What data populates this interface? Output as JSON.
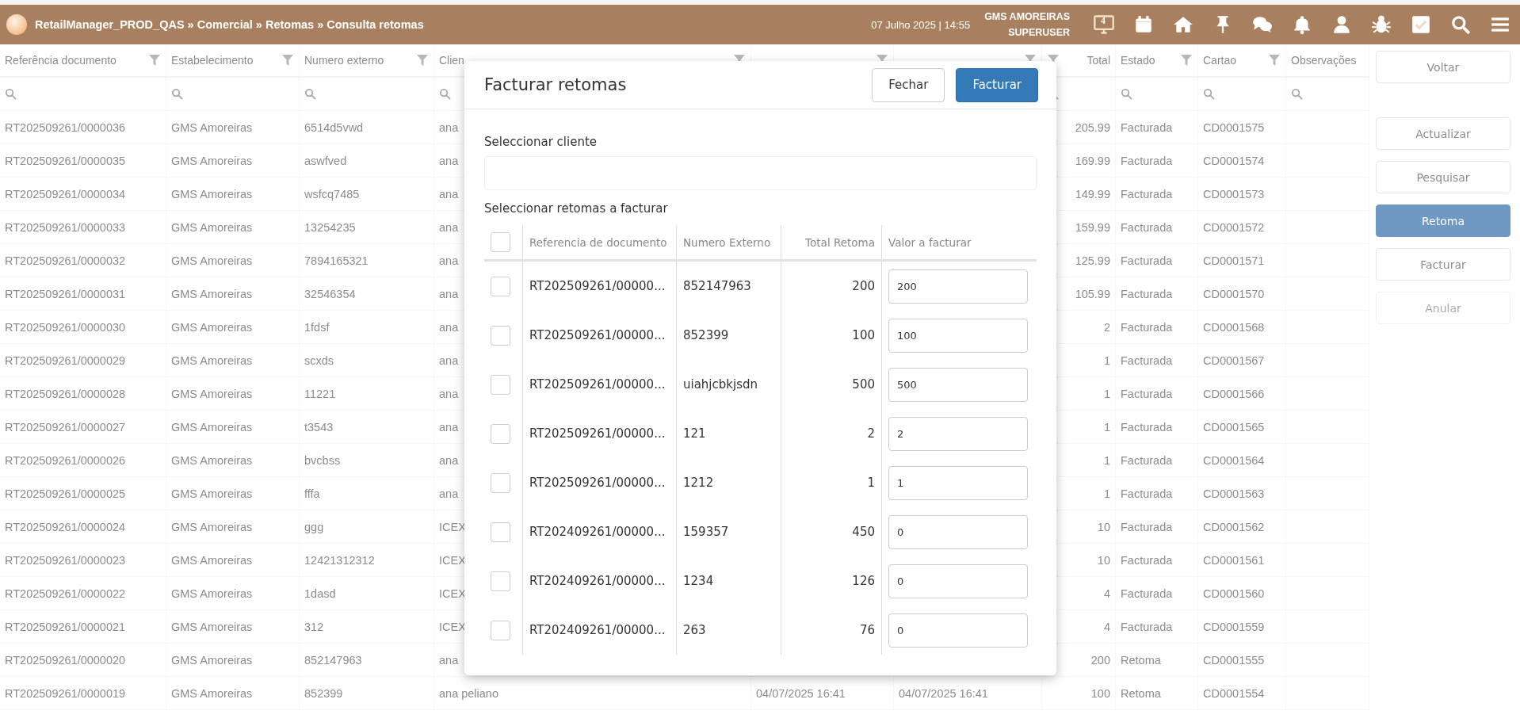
{
  "header": {
    "breadcrumb": "RetailManager_PROD_QAS » Comercial » Retomas » Consulta retomas",
    "datetime": "07 Julho 2025 | 14:55",
    "store": "GMS AMOREIRAS",
    "user": "SUPERUSER",
    "monitor_badge": "4"
  },
  "table": {
    "columns": [
      {
        "label": "Referência documento",
        "filter": true
      },
      {
        "label": "Estabelecimento",
        "filter": true
      },
      {
        "label": "Numero externo",
        "filter": true
      },
      {
        "label": "Clien",
        "filter": true
      },
      {
        "filter": true
      },
      {
        "filter": true
      },
      {
        "label": "Total",
        "filter": true
      },
      {
        "label": "Estado",
        "filter": true
      },
      {
        "label": "Cartao",
        "filter": true
      },
      {
        "label": "Observações",
        "filter": false
      }
    ],
    "rows": [
      {
        "reference": "RT202509261/0000036",
        "establishment": "GMS Amoreiras",
        "external": "6514d5vwd",
        "client": "ana",
        "total": "205.99",
        "status": "Facturada",
        "card": "CD0001575"
      },
      {
        "reference": "RT202509261/0000035",
        "establishment": "GMS Amoreiras",
        "external": "aswfved",
        "client": "ana",
        "total": "169.99",
        "status": "Facturada",
        "card": "CD0001574"
      },
      {
        "reference": "RT202509261/0000034",
        "establishment": "GMS Amoreiras",
        "external": "wsfcq7485",
        "client": "ana",
        "total": "149.99",
        "status": "Facturada",
        "card": "CD0001573"
      },
      {
        "reference": "RT202509261/0000033",
        "establishment": "GMS Amoreiras",
        "external": "13254235",
        "client": "ana",
        "total": "159.99",
        "status": "Facturada",
        "card": "CD0001572"
      },
      {
        "reference": "RT202509261/0000032",
        "establishment": "GMS Amoreiras",
        "external": "7894165321",
        "client": "ana",
        "total": "125.99",
        "status": "Facturada",
        "card": "CD0001571"
      },
      {
        "reference": "RT202509261/0000031",
        "establishment": "GMS Amoreiras",
        "external": "32546354",
        "client": "ana",
        "total": "105.99",
        "status": "Facturada",
        "card": "CD0001570"
      },
      {
        "reference": "RT202509261/0000030",
        "establishment": "GMS Amoreiras",
        "external": "1fdsf",
        "client": "ana",
        "total": "2",
        "status": "Facturada",
        "card": "CD0001568"
      },
      {
        "reference": "RT202509261/0000029",
        "establishment": "GMS Amoreiras",
        "external": "scxds",
        "client": "ana",
        "total": "1",
        "status": "Facturada",
        "card": "CD0001567"
      },
      {
        "reference": "RT202509261/0000028",
        "establishment": "GMS Amoreiras",
        "external": "11221",
        "client": "ana",
        "total": "1",
        "status": "Facturada",
        "card": "CD0001566"
      },
      {
        "reference": "RT202509261/0000027",
        "establishment": "GMS Amoreiras",
        "external": "t3543",
        "client": "ana",
        "total": "1",
        "status": "Facturada",
        "card": "CD0001565"
      },
      {
        "reference": "RT202509261/0000026",
        "establishment": "GMS Amoreiras",
        "external": "bvcbss",
        "client": "ana",
        "total": "1",
        "status": "Facturada",
        "card": "CD0001564"
      },
      {
        "reference": "RT202509261/0000025",
        "establishment": "GMS Amoreiras",
        "external": "fffa",
        "client": "ana",
        "total": "1",
        "status": "Facturada",
        "card": "CD0001563"
      },
      {
        "reference": "RT202509261/0000024",
        "establishment": "GMS Amoreiras",
        "external": "ggg",
        "client": "ICEX",
        "total": "10",
        "status": "Facturada",
        "card": "CD0001562"
      },
      {
        "reference": "RT202509261/0000023",
        "establishment": "GMS Amoreiras",
        "external": "12421312312",
        "client": "ICEX",
        "total": "10",
        "status": "Facturada",
        "card": "CD0001561"
      },
      {
        "reference": "RT202509261/0000022",
        "establishment": "GMS Amoreiras",
        "external": "1dasd",
        "client": "ICEX",
        "total": "4",
        "status": "Facturada",
        "card": "CD0001560"
      },
      {
        "reference": "RT202509261/0000021",
        "establishment": "GMS Amoreiras",
        "external": "312",
        "client": "ICEX",
        "total": "4",
        "status": "Facturada",
        "card": "CD0001559"
      },
      {
        "reference": "RT202509261/0000020",
        "establishment": "GMS Amoreiras",
        "external": "852147963",
        "client": "ana",
        "total": "200",
        "status": "Retoma",
        "card": "CD0001555"
      },
      {
        "reference": "RT202509261/0000019",
        "establishment": "GMS Amoreiras",
        "external": "852399",
        "client": "ana peliano",
        "created": "04/07/2025 16:41",
        "modified": "04/07/2025 16:41",
        "total": "100",
        "status": "Retoma",
        "card": "CD0001554"
      }
    ]
  },
  "actions": [
    {
      "label": "Voltar",
      "selected": false,
      "disabled": false
    },
    {
      "label": "Actualizar",
      "selected": false,
      "disabled": false
    },
    {
      "label": "Pesquisar",
      "selected": false,
      "disabled": false
    },
    {
      "label": "Retoma",
      "selected": true,
      "disabled": false
    },
    {
      "label": "Facturar",
      "selected": false,
      "disabled": false
    },
    {
      "label": "Anular",
      "selected": false,
      "disabled": true
    }
  ],
  "modal": {
    "title": "Facturar retomas",
    "buttons": [
      {
        "label": "Fechar",
        "kind": "default"
      },
      {
        "label": "Facturar",
        "kind": "primary"
      }
    ],
    "client_label": "Seleccionar cliente",
    "list_label": "Seleccionar retomas a facturar",
    "columns": [
      "Referencia de documento",
      "Numero Externo",
      "Total Retoma",
      "Valor a facturar"
    ],
    "select_all_checked": false,
    "rows": [
      {
        "checked": false,
        "reference": "RT202509261/00000...",
        "external": "852147963",
        "total": "200",
        "value": "200"
      },
      {
        "checked": false,
        "reference": "RT202509261/00000...",
        "external": "852399",
        "total": "100",
        "value": "100"
      },
      {
        "checked": false,
        "reference": "RT202509261/00000...",
        "external": "uiahjcbkjsdn",
        "total": "500",
        "value": "500"
      },
      {
        "checked": false,
        "reference": "RT202509261/00000...",
        "external": "121",
        "total": "2",
        "value": "2"
      },
      {
        "checked": false,
        "reference": "RT202509261/00000...",
        "external": "1212",
        "total": "1",
        "value": "1"
      },
      {
        "checked": false,
        "reference": "RT202409261/00000...",
        "external": "159357",
        "total": "450",
        "value": "0"
      },
      {
        "checked": false,
        "reference": "RT202409261/00000...",
        "external": "1234",
        "total": "126",
        "value": "0"
      },
      {
        "checked": false,
        "reference": "RT202409261/00000...",
        "external": "263",
        "total": "76",
        "value": "0"
      }
    ]
  }
}
